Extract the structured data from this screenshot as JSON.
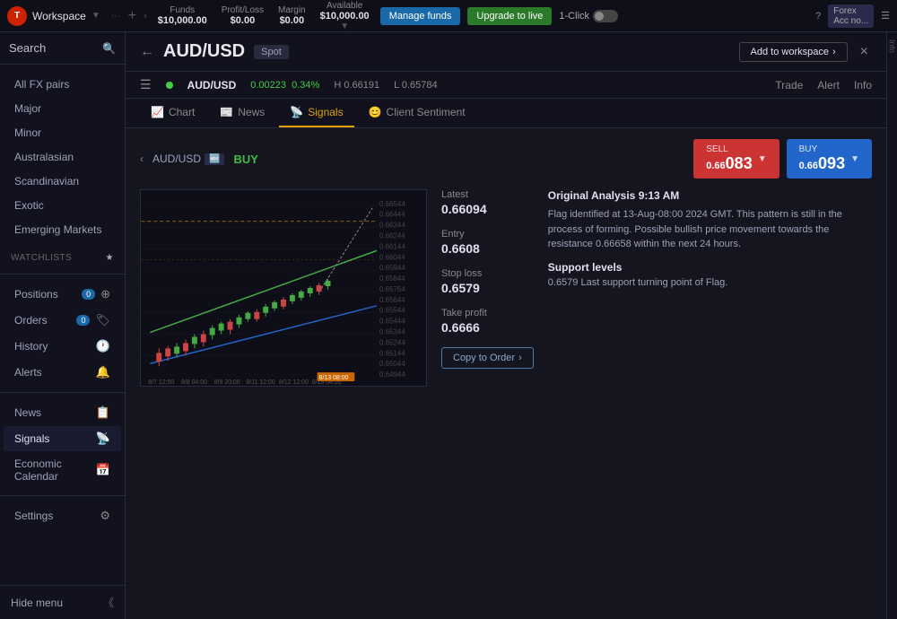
{
  "topbar": {
    "logo": "T",
    "workspace": "Workspace",
    "funds_label": "Funds",
    "funds_value": "$10,000.00",
    "pnl_label": "Profit/Loss",
    "pnl_value": "$0.00",
    "margin_label": "Margin",
    "margin_value": "$0.00",
    "available_label": "Available",
    "available_value": "$10,000.00",
    "manage_funds": "Manage funds",
    "upgrade_live": "Upgrade to live",
    "one_click": "1-Click",
    "forex_label": "Forex",
    "acc_label": "Acc no...",
    "close_icon": "×"
  },
  "sidebar": {
    "search_label": "Search",
    "nav_items": [
      {
        "label": "All FX pairs",
        "active": false
      },
      {
        "label": "Major",
        "active": false
      },
      {
        "label": "Minor",
        "active": false
      },
      {
        "label": "Australasian",
        "active": false
      },
      {
        "label": "Scandinavian",
        "active": false
      },
      {
        "label": "Exotic",
        "active": false
      },
      {
        "label": "Emerging Markets",
        "active": false
      }
    ],
    "watchlists_label": "WATCHLISTS",
    "positions_label": "Positions",
    "positions_count": "0",
    "orders_label": "Orders",
    "orders_count": "0",
    "history_label": "History",
    "alerts_label": "Alerts",
    "news_label": "News",
    "signals_label": "Signals",
    "economic_calendar_label": "Economic Calendar",
    "settings_label": "Settings",
    "hide_menu_label": "Hide menu"
  },
  "content": {
    "back_arrow": "←",
    "pair_title": "AUD/USD",
    "spot_label": "Spot",
    "add_workspace": "Add to workspace",
    "close": "×",
    "tabs": [
      {
        "label": "Chart",
        "icon": "📈",
        "active": false
      },
      {
        "label": "News",
        "icon": "📰",
        "active": false
      },
      {
        "label": "Signals",
        "icon": "📡",
        "active": true
      },
      {
        "label": "Client Sentiment",
        "icon": "😊",
        "active": false
      }
    ],
    "pair_info": {
      "pair": "AUD/USD",
      "change": "0.00223",
      "change_pct": "0.34%",
      "high": "H 0.66191",
      "low": "L 0.65784",
      "tabs_right": [
        "Trade",
        "Alert",
        "Info"
      ]
    },
    "signal": {
      "breadcrumb_pair": "AUD/USD",
      "direction": "BUY",
      "sell_label": "SELL",
      "sell_price_main": "0.66",
      "sell_price_bold": "083",
      "buy_label": "BUY",
      "buy_price_main": "0.66",
      "buy_price_bold": "093",
      "latest_label": "Latest",
      "latest_value": "0.66094",
      "entry_label": "Entry",
      "entry_value": "0.6608",
      "stoploss_label": "Stop loss",
      "stoploss_value": "0.6579",
      "takeprofit_label": "Take profit",
      "takeprofit_value": "0.6666",
      "analysis_title": "Original Analysis 9:13 AM",
      "analysis_text": "Flag identified at 13-Aug-08:00 2024 GMT. This pattern is still in the process of forming. Possible bullish price movement towards the resistance 0.66658 within the next 24 hours.",
      "support_title": "Support levels",
      "support_text": "0.6579 Last support turning point of Flag.",
      "copy_order": "Copy to Order"
    }
  }
}
